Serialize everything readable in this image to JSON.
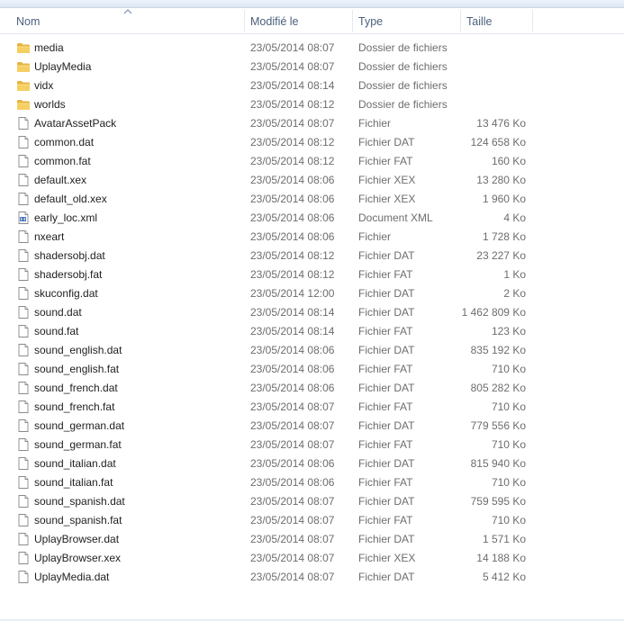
{
  "columns": {
    "name": "Nom",
    "date": "Modifié le",
    "type": "Type",
    "size": "Taille"
  },
  "icons": {
    "folder": "folder-icon",
    "file": "file-icon",
    "xml": "xml-file-icon"
  },
  "colors": {
    "folder": "#f2c14e",
    "header_text": "#4c607a",
    "meta_text": "#6d6d6d"
  },
  "files": [
    {
      "icon": "folder",
      "name": "media",
      "date": "23/05/2014 08:07",
      "type": "Dossier de fichiers",
      "size": ""
    },
    {
      "icon": "folder",
      "name": "UplayMedia",
      "date": "23/05/2014 08:07",
      "type": "Dossier de fichiers",
      "size": ""
    },
    {
      "icon": "folder",
      "name": "vidx",
      "date": "23/05/2014 08:14",
      "type": "Dossier de fichiers",
      "size": ""
    },
    {
      "icon": "folder",
      "name": "worlds",
      "date": "23/05/2014 08:12",
      "type": "Dossier de fichiers",
      "size": ""
    },
    {
      "icon": "file",
      "name": "AvatarAssetPack",
      "date": "23/05/2014 08:07",
      "type": "Fichier",
      "size": "13 476 Ko"
    },
    {
      "icon": "file",
      "name": "common.dat",
      "date": "23/05/2014 08:12",
      "type": "Fichier DAT",
      "size": "124 658 Ko"
    },
    {
      "icon": "file",
      "name": "common.fat",
      "date": "23/05/2014 08:12",
      "type": "Fichier FAT",
      "size": "160 Ko"
    },
    {
      "icon": "file",
      "name": "default.xex",
      "date": "23/05/2014 08:06",
      "type": "Fichier XEX",
      "size": "13 280 Ko"
    },
    {
      "icon": "file",
      "name": "default_old.xex",
      "date": "23/05/2014 08:06",
      "type": "Fichier XEX",
      "size": "1 960 Ko"
    },
    {
      "icon": "xml",
      "name": "early_loc.xml",
      "date": "23/05/2014 08:06",
      "type": "Document XML",
      "size": "4 Ko"
    },
    {
      "icon": "file",
      "name": "nxeart",
      "date": "23/05/2014 08:06",
      "type": "Fichier",
      "size": "1 728 Ko"
    },
    {
      "icon": "file",
      "name": "shadersobj.dat",
      "date": "23/05/2014 08:12",
      "type": "Fichier DAT",
      "size": "23 227 Ko"
    },
    {
      "icon": "file",
      "name": "shadersobj.fat",
      "date": "23/05/2014 08:12",
      "type": "Fichier FAT",
      "size": "1 Ko"
    },
    {
      "icon": "file",
      "name": "skuconfig.dat",
      "date": "23/05/2014 12:00",
      "type": "Fichier DAT",
      "size": "2 Ko"
    },
    {
      "icon": "file",
      "name": "sound.dat",
      "date": "23/05/2014 08:14",
      "type": "Fichier DAT",
      "size": "1 462 809 Ko"
    },
    {
      "icon": "file",
      "name": "sound.fat",
      "date": "23/05/2014 08:14",
      "type": "Fichier FAT",
      "size": "123 Ko"
    },
    {
      "icon": "file",
      "name": "sound_english.dat",
      "date": "23/05/2014 08:06",
      "type": "Fichier DAT",
      "size": "835 192 Ko"
    },
    {
      "icon": "file",
      "name": "sound_english.fat",
      "date": "23/05/2014 08:06",
      "type": "Fichier FAT",
      "size": "710 Ko"
    },
    {
      "icon": "file",
      "name": "sound_french.dat",
      "date": "23/05/2014 08:06",
      "type": "Fichier DAT",
      "size": "805 282 Ko"
    },
    {
      "icon": "file",
      "name": "sound_french.fat",
      "date": "23/05/2014 08:07",
      "type": "Fichier FAT",
      "size": "710 Ko"
    },
    {
      "icon": "file",
      "name": "sound_german.dat",
      "date": "23/05/2014 08:07",
      "type": "Fichier DAT",
      "size": "779 556 Ko"
    },
    {
      "icon": "file",
      "name": "sound_german.fat",
      "date": "23/05/2014 08:07",
      "type": "Fichier FAT",
      "size": "710 Ko"
    },
    {
      "icon": "file",
      "name": "sound_italian.dat",
      "date": "23/05/2014 08:06",
      "type": "Fichier DAT",
      "size": "815 940 Ko"
    },
    {
      "icon": "file",
      "name": "sound_italian.fat",
      "date": "23/05/2014 08:06",
      "type": "Fichier FAT",
      "size": "710 Ko"
    },
    {
      "icon": "file",
      "name": "sound_spanish.dat",
      "date": "23/05/2014 08:07",
      "type": "Fichier DAT",
      "size": "759 595 Ko"
    },
    {
      "icon": "file",
      "name": "sound_spanish.fat",
      "date": "23/05/2014 08:07",
      "type": "Fichier FAT",
      "size": "710 Ko"
    },
    {
      "icon": "file",
      "name": "UplayBrowser.dat",
      "date": "23/05/2014 08:07",
      "type": "Fichier DAT",
      "size": "1 571 Ko"
    },
    {
      "icon": "file",
      "name": "UplayBrowser.xex",
      "date": "23/05/2014 08:07",
      "type": "Fichier XEX",
      "size": "14 188 Ko"
    },
    {
      "icon": "file",
      "name": "UplayMedia.dat",
      "date": "23/05/2014 08:07",
      "type": "Fichier DAT",
      "size": "5 412 Ko"
    }
  ]
}
